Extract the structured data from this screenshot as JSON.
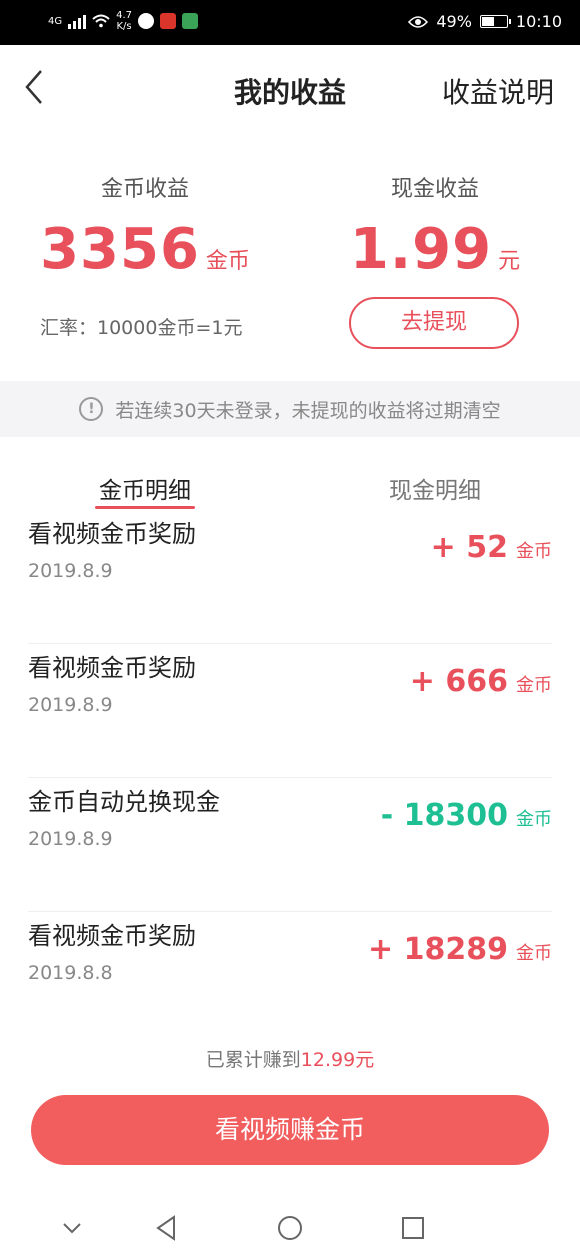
{
  "status_bar": {
    "network": "4G",
    "speed_value": "4.7",
    "speed_unit": "K/s",
    "battery": "49%",
    "time": "10:10"
  },
  "header": {
    "title": "我的收益",
    "right_link": "收益说明"
  },
  "summary": {
    "coin_label": "金币收益",
    "coin_value": "3356",
    "coin_unit": "金币",
    "cash_label": "现金收益",
    "cash_value": "1.99",
    "cash_unit": "元",
    "rate_text": "汇率：10000金币=1元",
    "withdraw_label": "去提现"
  },
  "notice": {
    "text": "若连续30天未登录，未提现的收益将过期清空"
  },
  "tabs": {
    "coin_detail": "金币明细",
    "cash_detail": "现金明细"
  },
  "records": [
    {
      "title": "看视频金币奖励",
      "date": "2019.8.9",
      "amount": "+ 52",
      "unit": "金币",
      "kind": "pos"
    },
    {
      "title": "看视频金币奖励",
      "date": "2019.8.9",
      "amount": "+ 666",
      "unit": "金币",
      "kind": "pos"
    },
    {
      "title": "金币自动兑换现金",
      "date": "2019.8.9",
      "amount": "- 18300",
      "unit": "金币",
      "kind": "neg"
    },
    {
      "title": "看视频金币奖励",
      "date": "2019.8.8",
      "amount": "+ 18289",
      "unit": "金币",
      "kind": "pos"
    }
  ],
  "footer": {
    "total_prefix": "已累计赚到",
    "total_value": "12.99元",
    "cta_label": "看视频赚金币"
  },
  "colors": {
    "accent": "#e8505b",
    "negative": "#1fbf94",
    "button": "#f25d5d"
  }
}
